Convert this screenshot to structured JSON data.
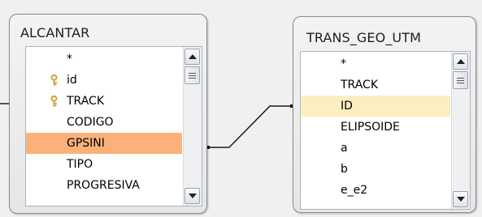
{
  "tables": [
    {
      "title": "ALCANTAR",
      "fields": [
        {
          "label": "*",
          "key": false,
          "highlight": "none"
        },
        {
          "label": "id",
          "key": true,
          "highlight": "none"
        },
        {
          "label": "TRACK",
          "key": true,
          "highlight": "none"
        },
        {
          "label": "CODIGO",
          "key": false,
          "highlight": "none"
        },
        {
          "label": "GPSINI",
          "key": false,
          "highlight": "orange"
        },
        {
          "label": "TIPO",
          "key": false,
          "highlight": "none"
        },
        {
          "label": "PROGRESIVA",
          "key": false,
          "highlight": "none"
        }
      ]
    },
    {
      "title": "TRANS_GEO_UTM",
      "fields": [
        {
          "label": "*",
          "key": false,
          "highlight": "none"
        },
        {
          "label": "TRACK",
          "key": false,
          "highlight": "none"
        },
        {
          "label": "ID",
          "key": false,
          "highlight": "light"
        },
        {
          "label": "ELIPSOIDE",
          "key": false,
          "highlight": "none"
        },
        {
          "label": "a",
          "key": false,
          "highlight": "none"
        },
        {
          "label": "b",
          "key": false,
          "highlight": "none"
        },
        {
          "label": "e_e2",
          "key": false,
          "highlight": "none"
        }
      ]
    }
  ],
  "colors": {
    "highlight_orange": "#fbb17a",
    "highlight_light": "#fdeec0",
    "relationship_line": "#1a1a1a",
    "key_icon": "#c8a030"
  }
}
